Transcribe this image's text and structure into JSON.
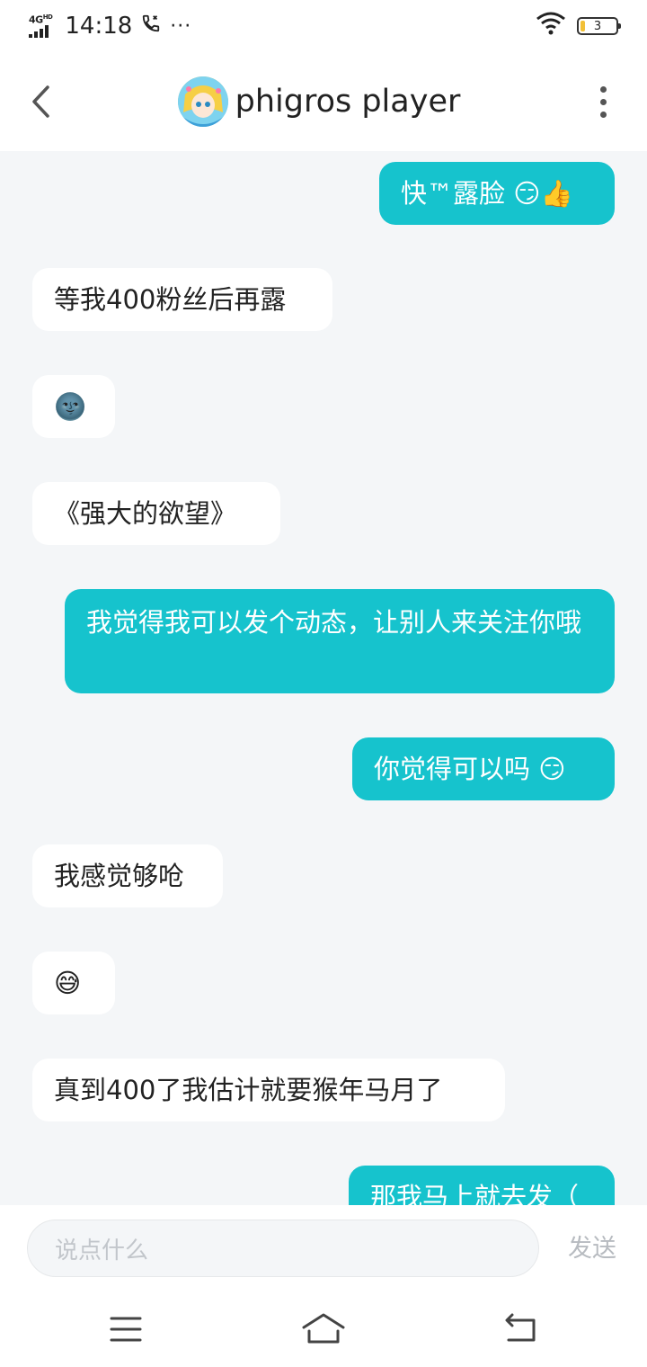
{
  "status_bar": {
    "network": "4G",
    "network_sup": "HD",
    "time": "14:18",
    "call_icon": "phone-icon",
    "more": "···",
    "wifi_icon": "wifi-icon",
    "battery": "3"
  },
  "header": {
    "title": "phigros player",
    "back_icon": "chevron-left-icon",
    "more_icon": "more-vertical-icon"
  },
  "messages": [
    {
      "side": "right",
      "text": "快™露脸 😏👍"
    },
    {
      "side": "left",
      "text": "等我400粉丝后再露"
    },
    {
      "side": "left",
      "text": "🌚"
    },
    {
      "side": "left",
      "text": "《强大的欲望》"
    },
    {
      "side": "right",
      "text": "我觉得我可以发个动态，让别人来关注你哦"
    },
    {
      "side": "right",
      "text": "你觉得可以吗 😏"
    },
    {
      "side": "left",
      "text": "我感觉够呛"
    },
    {
      "side": "left",
      "text": "😅"
    },
    {
      "side": "left",
      "text": "真到400了我估计就要猴年马月了"
    },
    {
      "side": "right",
      "text": "那我马上就去发（"
    }
  ],
  "input": {
    "placeholder": "说点什么",
    "send_label": "发送"
  },
  "colors": {
    "accent": "#16c3cd",
    "background": "#f4f6f8"
  },
  "navbar": {
    "menu_icon": "menu-icon",
    "home_icon": "home-icon",
    "back_icon": "return-icon"
  }
}
